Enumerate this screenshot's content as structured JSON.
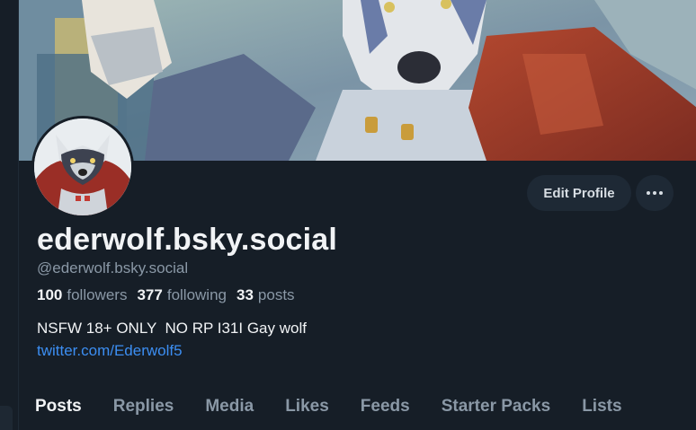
{
  "profile": {
    "display_name": "ederwolf.bsky.social",
    "handle": "@ederwolf.bsky.social",
    "bio": "NSFW 18+ ONLY  NO RP I31I Gay wolf",
    "link": "twitter.com/Ederwolf5"
  },
  "stats": [
    {
      "count": "100",
      "label": "followers"
    },
    {
      "count": "377",
      "label": "following"
    },
    {
      "count": "33",
      "label": "posts"
    }
  ],
  "actions": {
    "edit_profile": "Edit Profile",
    "more_icon": "ellipsis-horizontal-icon"
  },
  "tabs": [
    {
      "label": "Posts",
      "active": true
    },
    {
      "label": "Replies",
      "active": false
    },
    {
      "label": "Media",
      "active": false
    },
    {
      "label": "Likes",
      "active": false
    },
    {
      "label": "Feeds",
      "active": false
    },
    {
      "label": "Starter Packs",
      "active": false
    },
    {
      "label": "Lists",
      "active": false
    }
  ],
  "colors": {
    "background": "#161e27",
    "button_bg": "#1e2935",
    "link": "#3c8ef2",
    "muted_text": "#8a98a6",
    "primary_text": "#f1f3f5"
  }
}
